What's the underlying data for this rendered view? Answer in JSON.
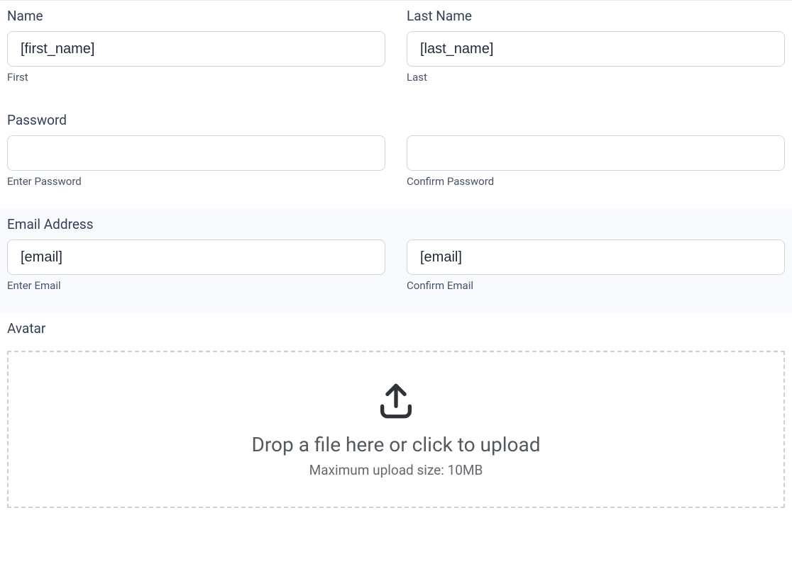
{
  "name": {
    "label": "Name",
    "lastLabel": "Last Name",
    "first": {
      "value": "[first_name]",
      "sublabel": "First"
    },
    "last": {
      "value": "[last_name]",
      "sublabel": "Last"
    }
  },
  "password": {
    "label": "Password",
    "enter": {
      "value": "",
      "sublabel": "Enter Password"
    },
    "confirm": {
      "value": "",
      "sublabel": "Confirm Password"
    }
  },
  "email": {
    "label": "Email Address",
    "enter": {
      "value": "[email]",
      "sublabel": "Enter Email"
    },
    "confirm": {
      "value": "[email]",
      "sublabel": "Confirm Email"
    }
  },
  "avatar": {
    "label": "Avatar",
    "drop_title": "Drop a file here or click to upload",
    "drop_sub": "Maximum upload size: 10MB"
  }
}
